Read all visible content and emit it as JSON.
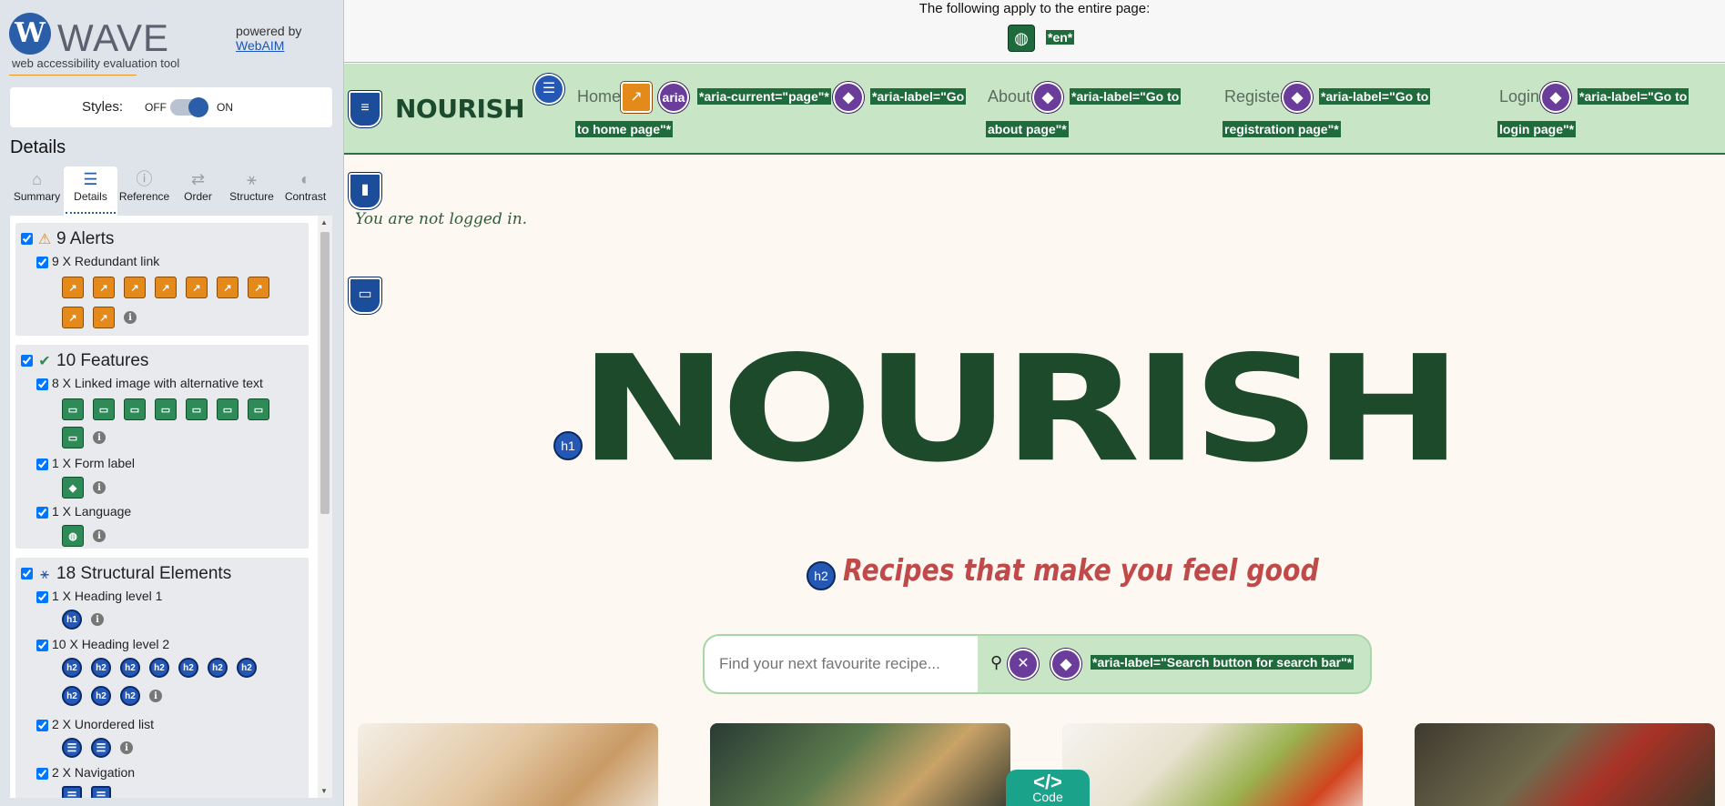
{
  "wave": {
    "logo_letter": "W",
    "logo_word": "WAVE",
    "subtitle": "web accessibility evaluation tool",
    "powered_by": "powered by",
    "powered_link": "WebAIM",
    "styles_label": "Styles:",
    "styles_off": "OFF",
    "styles_on": "ON",
    "details_title": "Details",
    "tabs": [
      {
        "label": "Summary",
        "icon": "home-icon",
        "glyph": "⌂"
      },
      {
        "label": "Details",
        "icon": "list-icon",
        "glyph": "☰"
      },
      {
        "label": "Reference",
        "icon": "info-icon",
        "glyph": "ⓘ"
      },
      {
        "label": "Order",
        "icon": "order-icon",
        "glyph": "⇄"
      },
      {
        "label": "Structure",
        "icon": "structure-icon",
        "glyph": "⚹"
      },
      {
        "label": "Contrast",
        "icon": "contrast-icon",
        "glyph": "◐"
      }
    ],
    "groups": {
      "alerts": {
        "title": "9 Alerts",
        "items": [
          {
            "label": "9 X Redundant link"
          }
        ]
      },
      "features": {
        "title": "10 Features",
        "items": [
          {
            "label": "8 X Linked image with alternative text"
          },
          {
            "label": "1 X Form label"
          },
          {
            "label": "1 X Language"
          }
        ]
      },
      "structural": {
        "title": "18 Structural Elements",
        "items": [
          {
            "label": "1 X Heading level 1"
          },
          {
            "label": "10 X Heading level 2"
          },
          {
            "label": "2 X Unordered list"
          },
          {
            "label": "2 X Navigation"
          }
        ]
      }
    },
    "h1_label": "h1",
    "h2_label": "h2"
  },
  "page": {
    "whole_page_text": "The following apply to the entire page:",
    "lang_highlight": "*en*",
    "brand": "NOURISH",
    "nav": [
      {
        "label": "Home",
        "aria_current": "*aria-current=\"page\"*",
        "aria_label_1": "*aria-label=\"Go",
        "aria_label_2": "to home page\"*"
      },
      {
        "label": "About",
        "aria_label_1": "*aria-label=\"Go to",
        "aria_label_2": "about page\"*"
      },
      {
        "label": "Register",
        "aria_label_1": "*aria-label=\"Go to",
        "aria_label_2": "registration page\"*"
      },
      {
        "label": "Login",
        "aria_label_1": "*aria-label=\"Go to",
        "aria_label_2": "login page\"*"
      }
    ],
    "aria_badge": "aria",
    "not_logged_in": "You are not logged in.",
    "hero_title": "NOURISH",
    "hero_subtitle": "Recipes that make you feel good",
    "search_placeholder": "Find your next favourite recipe...",
    "search_aria": "*aria-label=\"Search button for search bar\"*",
    "code_button": "Code",
    "code_glyph": "</>"
  },
  "colors": {
    "brand_green": "#1e4a2c",
    "nav_bg": "#c8e6c6",
    "accent_red": "#c04a4a",
    "wave_blue": "#2a5ea8",
    "alert_orange": "#e48a1a",
    "aria_purple": "#6a3d9a"
  }
}
